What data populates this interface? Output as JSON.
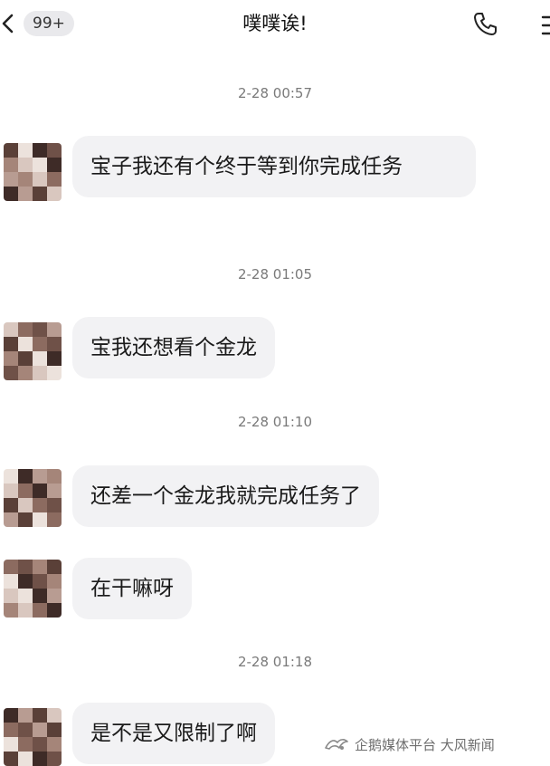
{
  "header": {
    "unread_badge": "99+",
    "title": "噗噗诶!"
  },
  "messages": [
    {
      "time": "2-28 00:57",
      "text": "宝子我还有个终于等到你完成任务"
    },
    {
      "time": "2-28 01:05",
      "text": "宝我还想看个金龙"
    },
    {
      "time": "2-28 01:10",
      "text": "还差一个金龙我就完成任务了"
    },
    {
      "time": "",
      "text": "在干嘛呀"
    },
    {
      "time": "2-28 01:18",
      "text": "是不是又限制了啊"
    }
  ],
  "watermark": {
    "text": "企鹅媒体平台 大风新闻"
  },
  "icons": {
    "back": "chevron-left-icon",
    "call": "phone-icon",
    "more": "menu-icon"
  }
}
